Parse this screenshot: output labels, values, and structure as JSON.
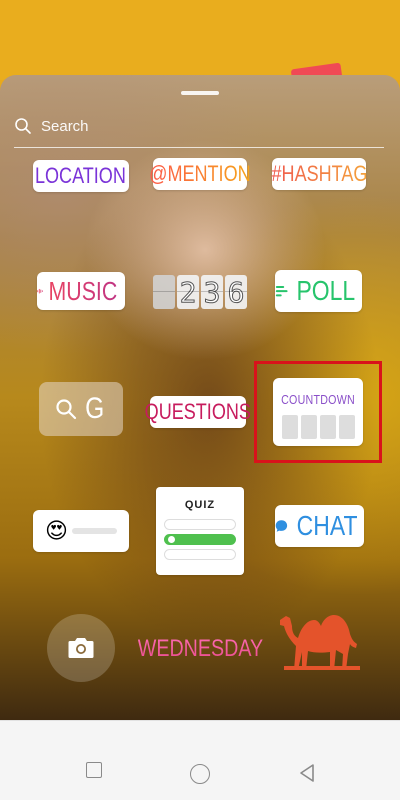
{
  "search": {
    "placeholder": "Search"
  },
  "stickers": {
    "location": "LOCATION",
    "mention": "@MENTION",
    "hashtag": "#HASHTAG",
    "music": "MUSIC",
    "time": {
      "digits": [
        "",
        "2",
        "3",
        "6"
      ]
    },
    "poll": "POLL",
    "gif": "G",
    "questions": "QUESTIONS",
    "countdown": "COUNTDOWN",
    "quiz": "QUIZ",
    "chat": "CHAT",
    "wednesday": "WEDNESDAY",
    "slider_emoji": "😍"
  },
  "colors": {
    "highlight": "#d9121b",
    "poll": "#27c46c",
    "chat": "#2f8fe0",
    "location": "#7a33d8",
    "countdown": "#8a4fc9"
  },
  "icons": [
    "search-icon",
    "location-pin-icon",
    "music-bars-icon",
    "poll-lines-icon",
    "magnifier-icon",
    "chat-bubble-icon",
    "camera-icon",
    "camel-icon"
  ],
  "navbar": {
    "buttons": [
      "recents",
      "home",
      "back"
    ]
  }
}
